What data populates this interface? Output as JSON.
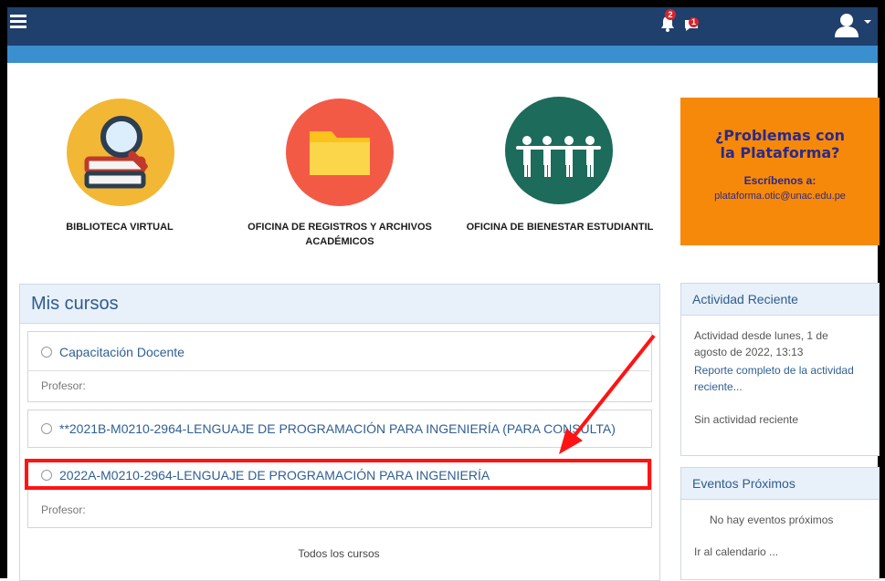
{
  "topbar": {
    "notifications_badge": "2",
    "messages_badge": "1",
    "icons": [
      "hamburger-menu-icon",
      "bell-icon",
      "message-icon",
      "user-avatar-icon",
      "caret-down-icon"
    ]
  },
  "tiles": [
    {
      "label": "BIBLIOTECA VIRTUAL",
      "icon": "library-books-magnifier-icon",
      "color": "#f2b734"
    },
    {
      "label": "OFICINA DE REGISTROS Y ARCHIVOS ACADÉMICOS",
      "icon": "folder-icon",
      "color": "#f35a46"
    },
    {
      "label": "OFICINA DE BIENESTAR ESTUDIANTIL",
      "icon": "people-group-icon",
      "color": "#1d6b5a"
    }
  ],
  "promo": {
    "title": "¿Problemas con la Plataforma?",
    "subtitle": "Escríbenos a:",
    "email": "plataforma.otic@unac.edu.pe"
  },
  "mis_cursos": {
    "title": "Mis cursos",
    "courses": [
      {
        "name": "Capacitación Docente",
        "teacher": "Profesor:"
      },
      {
        "name": "**2021B-M0210-2964-LENGUAJE DE PROGRAMACIÓN PARA INGENIERÍA (PARA CONSULTA)"
      },
      {
        "name": "2022A-M0210-2964-LENGUAJE DE PROGRAMACIÓN PARA INGENIERÍA",
        "teacher": "Profesor:"
      }
    ],
    "all_courses": "Todos los cursos"
  },
  "actividad": {
    "title": "Actividad Reciente",
    "since_line1": "Actividad desde lunes, 1 de",
    "since_line2": "agosto de 2022, 13:13",
    "report_line1": "Reporte completo de la actividad",
    "report_line2": "reciente...",
    "none": "Sin actividad reciente"
  },
  "eventos": {
    "title": "Eventos Próximos",
    "none": "No hay eventos próximos",
    "calendar": "Ir al calendario ..."
  },
  "colors": {
    "topbar": "#1f3f6c",
    "subbar": "#3a8fcf",
    "highlight": "#ff1313",
    "link": "#2f5f92"
  }
}
